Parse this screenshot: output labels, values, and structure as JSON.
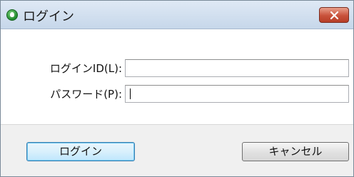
{
  "window": {
    "title": "ログイン",
    "icon": "app-icon",
    "close_icon": "close-icon"
  },
  "form": {
    "login_id_label": "ログインID(L):",
    "login_id_value": "",
    "password_label": "パスワード(P):",
    "password_value": ""
  },
  "buttons": {
    "login_label": "ログイン",
    "cancel_label": "キャンセル"
  },
  "colors": {
    "close_button": "#c8513a",
    "default_button_border": "#3c7fb1"
  }
}
